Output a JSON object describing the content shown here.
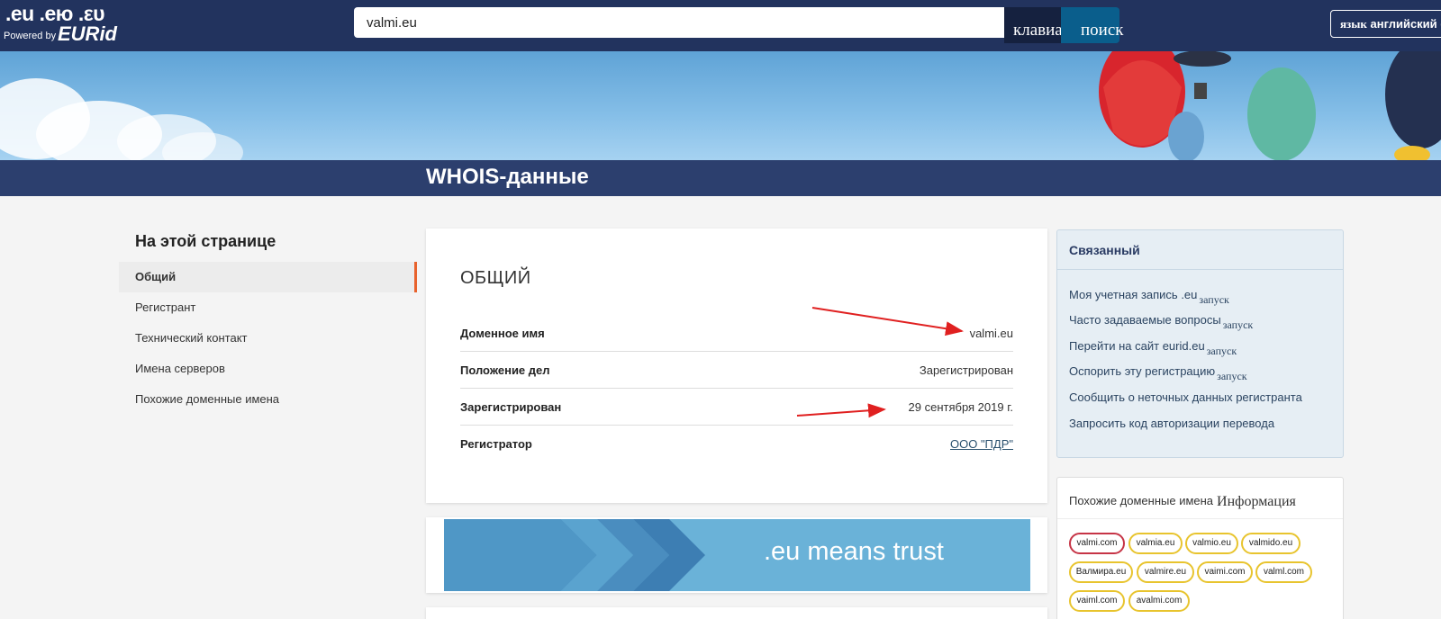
{
  "header": {
    "logo_domains": ".eu .ею .ευ",
    "logo_powered": "Powered by",
    "logo_brand": "EURid",
    "search_value": "valmi.eu",
    "keyboard_label": "клавиатура",
    "search_label": "поиск",
    "lang_prefix": "язык",
    "lang_value": "английский (ан"
  },
  "page_title": "WHOIS-данные",
  "toc": {
    "title": "На этой странице",
    "items": [
      "Общий",
      "Регистрант",
      "Технический контакт",
      "Имена серверов",
      "Похожие доменные имена"
    ]
  },
  "general": {
    "heading": "ОБЩИЙ",
    "rows": [
      {
        "label": "Доменное имя",
        "value": "valmi.eu"
      },
      {
        "label": "Положение дел",
        "value": "Зарегистрирован"
      },
      {
        "label": "Зарегистрирован",
        "value": "29 сентября 2019 г."
      },
      {
        "label": "Регистратор",
        "value": "ООО \"ПДР\""
      }
    ]
  },
  "banner": {
    "text": ".eu means trust"
  },
  "related": {
    "title": "Связанный",
    "links": [
      {
        "text": "Моя учетная запись .eu",
        "tag": "запуск"
      },
      {
        "text": "Часто задаваемые вопросы",
        "tag": "запуск"
      },
      {
        "text": "Перейти на сайт eurid.eu",
        "tag": "запуск"
      },
      {
        "text": "Оспорить эту регистрацию",
        "tag": "запуск"
      },
      {
        "text": "Сообщить о неточных данных регистранта",
        "tag": ""
      },
      {
        "text": "Запросить код авторизации перевода",
        "tag": ""
      }
    ]
  },
  "similar": {
    "title": "Похожие доменные имена",
    "info_label": "Информация",
    "chips": [
      "valmi.com",
      "valmia.eu",
      "valmio.eu",
      "valmido.eu",
      "Валмира.eu",
      "valmire.eu",
      "vaimi.com",
      "valml.com",
      "vaiml.com",
      "avalmi.com"
    ]
  },
  "colors": {
    "header_bg": "#22335e",
    "accent": "#e8622c",
    "chip_available": "#e8c42e",
    "chip_taken": "#c63446",
    "annotation_arrow": "#e02020"
  }
}
